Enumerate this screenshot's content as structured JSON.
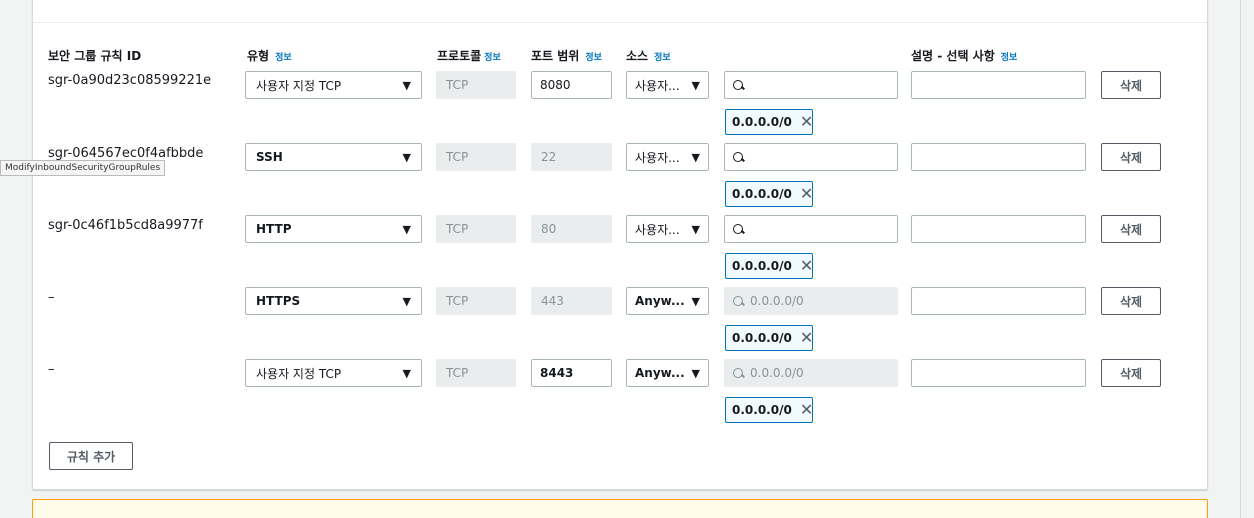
{
  "tooltip": "ModifyInboundSecurityGroupRules",
  "columns": {
    "rule_id": "보안 그룹 규칙 ID",
    "type": "유형",
    "protocol": "프로토콜",
    "port_range": "포트 범위",
    "source": "소스",
    "description": "설명 - 선택 사항",
    "info": "정보"
  },
  "rows": [
    {
      "id": "sgr-0a90d23c08599221e",
      "type": "사용자 지정 TCP",
      "protocol": "TCP",
      "port": "8080",
      "source": "사용자...",
      "search_placeholder": "",
      "token": "0.0.0.0/0",
      "delete": "삭제"
    },
    {
      "id": "sgr-064567ec0f4afbbde",
      "type": "SSH",
      "protocol": "TCP",
      "port": "22",
      "source": "사용자...",
      "search_placeholder": "",
      "token": "0.0.0.0/0",
      "delete": "삭제"
    },
    {
      "id": "sgr-0c46f1b5cd8a9977f",
      "type": "HTTP",
      "protocol": "TCP",
      "port": "80",
      "source": "사용자...",
      "search_placeholder": "",
      "token": "0.0.0.0/0",
      "delete": "삭제"
    },
    {
      "id": "–",
      "type": "HTTPS",
      "protocol": "TCP",
      "port": "443",
      "source": "Anyw...",
      "search_placeholder": "0.0.0.0/0",
      "token": "0.0.0.0/0",
      "delete": "삭제"
    },
    {
      "id": "–",
      "type": "사용자 지정 TCP",
      "protocol": "TCP",
      "port": "8443",
      "source": "Anyw...",
      "search_placeholder": "0.0.0.0/0",
      "token": "0.0.0.0/0",
      "delete": "삭제"
    }
  ],
  "add_rule_button": "규칙 추가",
  "colors": {
    "link": "#0073bb",
    "token_border": "#0073bb",
    "alert_border": "#ff9900",
    "alert_bg": "#fffce9"
  }
}
